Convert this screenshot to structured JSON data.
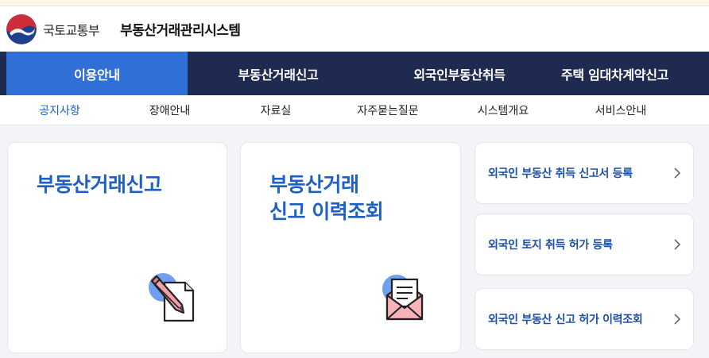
{
  "header": {
    "ministry": "국토교통부",
    "system_title": "부동산거래관리시스템"
  },
  "gnb": {
    "items": [
      {
        "label": "이용안내",
        "active": true
      },
      {
        "label": "부동산거래신고",
        "active": false
      },
      {
        "label": "외국인부동산취득",
        "active": false
      },
      {
        "label": "주택 임대차계약신고",
        "active": false
      }
    ]
  },
  "subnav": {
    "items": [
      {
        "label": "공지사항",
        "active": true
      },
      {
        "label": "장애안내",
        "active": false
      },
      {
        "label": "자료실",
        "active": false
      },
      {
        "label": "자주묻는질문",
        "active": false
      },
      {
        "label": "시스템개요",
        "active": false
      },
      {
        "label": "서비스안내",
        "active": false
      }
    ]
  },
  "cards": {
    "report": {
      "title": "부동산거래신고",
      "icon": "pen-document-icon"
    },
    "history": {
      "title_line1": "부동산거래",
      "title_line2": "신고 이력조회",
      "icon": "envelope-letter-icon"
    }
  },
  "links": [
    {
      "label": "외국인 부동산 취득 신고서 등록"
    },
    {
      "label": "외국인 토지 취득 허가 등록"
    },
    {
      "label": "외국인 부동산 신고 허가 이력조회"
    }
  ],
  "colors": {
    "navy": "#1e2a4f",
    "accent_blue": "#2f6fd6",
    "title_blue": "#1b5fc7",
    "background": "#f3f4f7"
  }
}
